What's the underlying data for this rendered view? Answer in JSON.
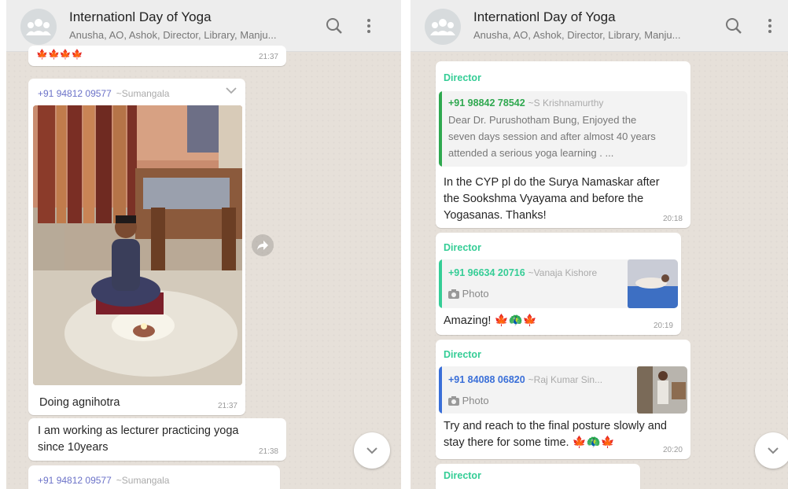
{
  "left": {
    "header": {
      "title": "Internationl Day of Yoga",
      "subtitle": "Anusha, AO, Ashok, Director, Library, Manju..."
    },
    "top_partial": {
      "emojis": "🍁🍁🍁🍁",
      "time": "21:37"
    },
    "image_message": {
      "phone": "+91 94812 09577",
      "name": "~Sumangala",
      "caption": "Doing agnihotra",
      "time": "21:37"
    },
    "text_message": {
      "line1": "I am working as lecturer practicing yoga",
      "line2": "since 10years",
      "time": "21:38"
    },
    "bottom_partial": {
      "phone": "+91 94812 09577",
      "name": "~Sumangala"
    }
  },
  "right": {
    "header": {
      "title": "Internationl Day of Yoga",
      "subtitle": "Anusha, AO, Ashok, Director, Library, Manju..."
    },
    "msg1": {
      "sender": "Director",
      "quote_phone": "+91 98842 78542",
      "quote_name": "~S Krishnamurthy",
      "quote_line1": "Dear Dr. Purushotham Bung, Enjoyed the",
      "quote_line2": "seven days session and after almost 40 years",
      "quote_line3": "attended a serious yoga  learning . ...",
      "line1": "In the CYP pl do the Surya Namaskar after",
      "line2": "the Sookshma Vyayama and before the",
      "line3": "Yogasanas. Thanks!",
      "time": "20:18"
    },
    "msg2": {
      "sender": "Director",
      "quote_phone": "+91 96634 20716",
      "quote_name": "~Vanaja Kishore",
      "photo_label": "Photo",
      "text": "Amazing! 🍁🦚🍁",
      "time": "20:19"
    },
    "msg3": {
      "sender": "Director",
      "quote_phone": "+91 84088 06820",
      "quote_name": "~Raj Kumar Sin...",
      "photo_label": "Photo",
      "line1": "Try and reach to the final posture slowly and",
      "line2": "stay there for some time. 🍁🦚🍁",
      "time": "20:20"
    },
    "msg4": {
      "sender": "Director"
    }
  },
  "colors": {
    "header_bg": "#ededed",
    "chat_bg": "#e6e0d9",
    "director_green": "#35cd96",
    "quote1_bar": "#2fa84f",
    "quote2_bar": "#35cd96",
    "quote3_bar": "#3a6fd8",
    "phone_purple": "#6b72c8"
  },
  "icons": [
    "group-avatar-icon",
    "search-icon",
    "menu-dots-icon",
    "chevron-down-icon",
    "forward-icon",
    "camera-icon"
  ]
}
